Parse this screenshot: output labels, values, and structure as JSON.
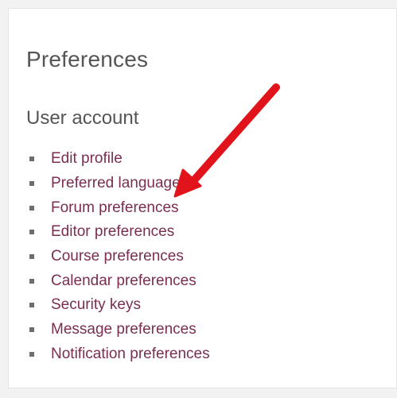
{
  "page": {
    "title": "Preferences"
  },
  "section": {
    "title": "User account",
    "links": [
      {
        "label": "Edit profile"
      },
      {
        "label": "Preferred language"
      },
      {
        "label": "Forum preferences"
      },
      {
        "label": "Editor preferences"
      },
      {
        "label": "Course preferences"
      },
      {
        "label": "Calendar preferences"
      },
      {
        "label": "Security keys"
      },
      {
        "label": "Message preferences"
      },
      {
        "label": "Notification preferences"
      }
    ]
  },
  "annotation": {
    "arrow_color": "#e0141a",
    "icon": "red-arrow-annotation"
  },
  "colors": {
    "link": "#7a2e50",
    "heading": "#555555",
    "background": "#f2f2f2"
  }
}
